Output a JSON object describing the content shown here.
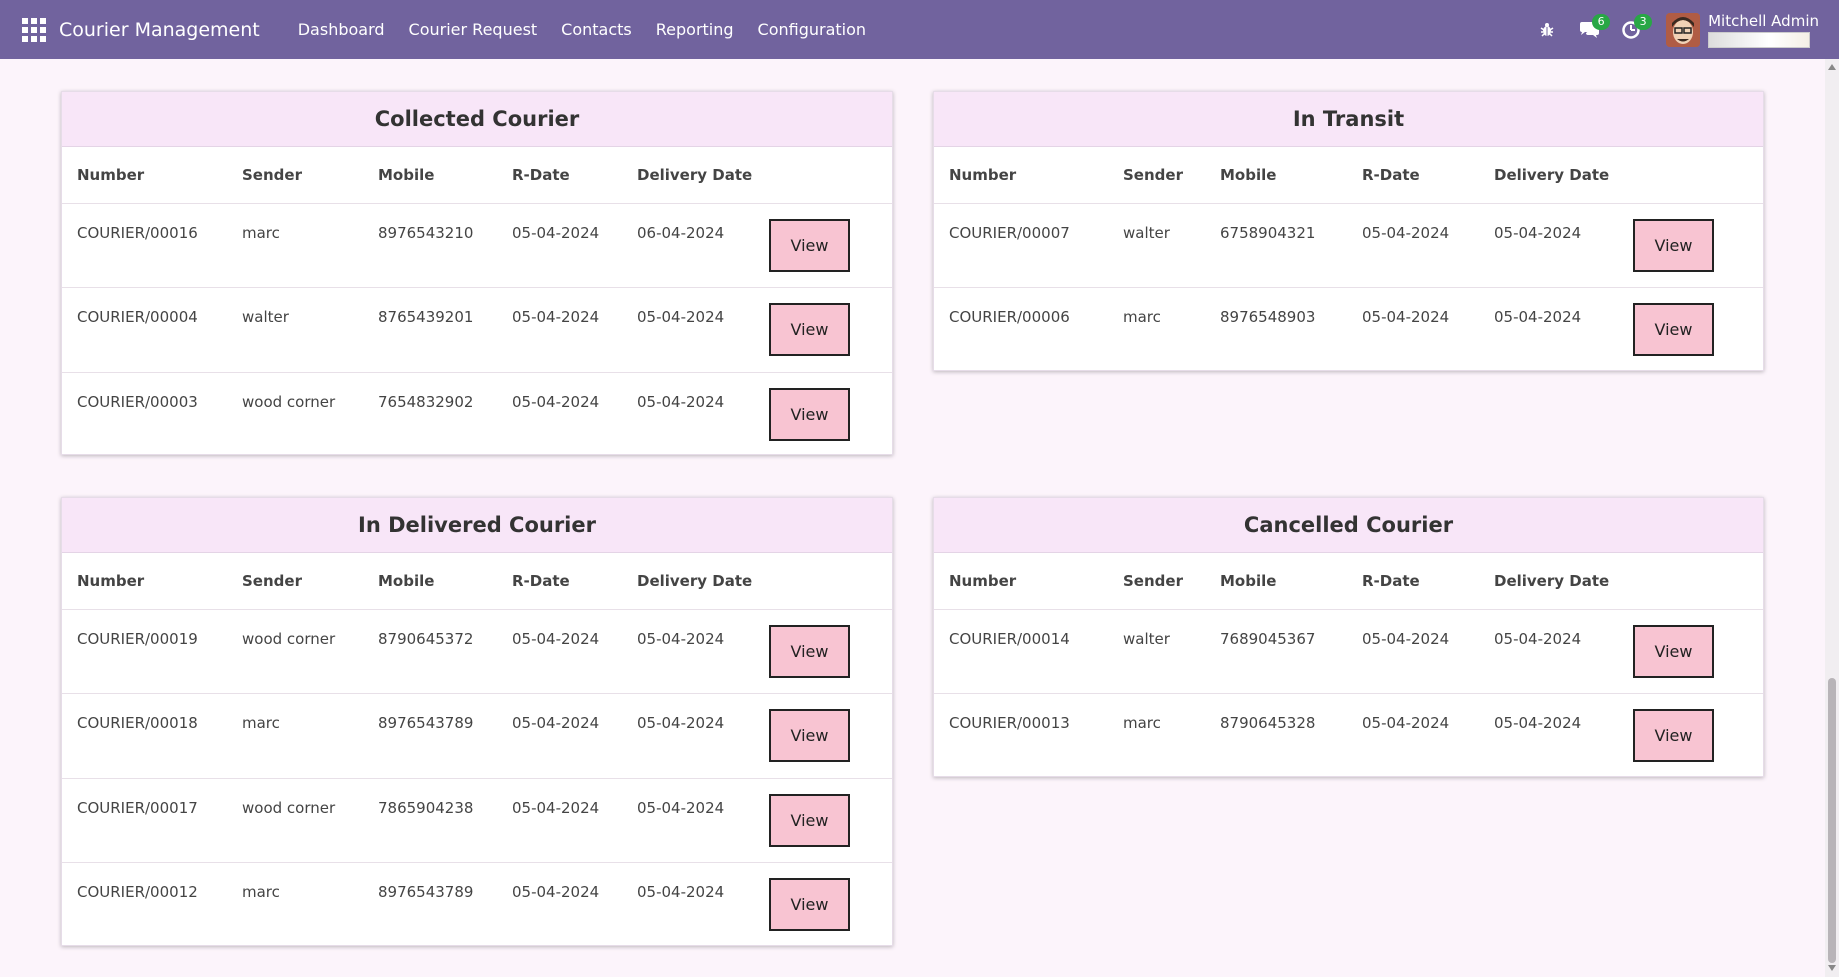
{
  "navbar": {
    "brand": "Courier Management",
    "menu": [
      "Dashboard",
      "Courier Request",
      "Contacts",
      "Reporting",
      "Configuration"
    ],
    "messages_badge": "6",
    "activities_badge": "3",
    "user_name": "Mitchell Admin",
    "icons": [
      "apps-grid-icon",
      "bug-icon",
      "chat-icon",
      "clock-icon"
    ]
  },
  "columns": [
    "Number",
    "Sender",
    "Mobile",
    "R-Date",
    "Delivery Date"
  ],
  "view_label": "View",
  "cards": {
    "collected": {
      "title": "Collected Courier",
      "rows": [
        [
          "COURIER/00016",
          "marc",
          "8976543210",
          "05-04-2024",
          "06-04-2024"
        ],
        [
          "COURIER/00004",
          "walter",
          "8765439201",
          "05-04-2024",
          "05-04-2024"
        ],
        [
          "COURIER/00003",
          "wood corner",
          "7654832902",
          "05-04-2024",
          "05-04-2024"
        ]
      ]
    },
    "transit": {
      "title": "In Transit",
      "rows": [
        [
          "COURIER/00007",
          "walter",
          "6758904321",
          "05-04-2024",
          "05-04-2024"
        ],
        [
          "COURIER/00006",
          "marc",
          "8976548903",
          "05-04-2024",
          "05-04-2024"
        ]
      ]
    },
    "delivered": {
      "title": "In Delivered Courier",
      "rows": [
        [
          "COURIER/00019",
          "wood corner",
          "8790645372",
          "05-04-2024",
          "05-04-2024"
        ],
        [
          "COURIER/00018",
          "marc",
          "8976543789",
          "05-04-2024",
          "05-04-2024"
        ],
        [
          "COURIER/00017",
          "wood corner",
          "7865904238",
          "05-04-2024",
          "05-04-2024"
        ],
        [
          "COURIER/00012",
          "marc",
          "8976543789",
          "05-04-2024",
          "05-04-2024"
        ]
      ]
    },
    "cancelled": {
      "title": "Cancelled Courier",
      "rows": [
        [
          "COURIER/00014",
          "walter",
          "7689045367",
          "05-04-2024",
          "05-04-2024"
        ],
        [
          "COURIER/00013",
          "marc",
          "8790645328",
          "05-04-2024",
          "05-04-2024"
        ]
      ]
    }
  },
  "colors": {
    "navbar": "#71639e",
    "card_header": "#f8e6f8",
    "view_button": "#f8c4d2",
    "badge": "#28a745",
    "page_bg": "#fcf4fb"
  }
}
